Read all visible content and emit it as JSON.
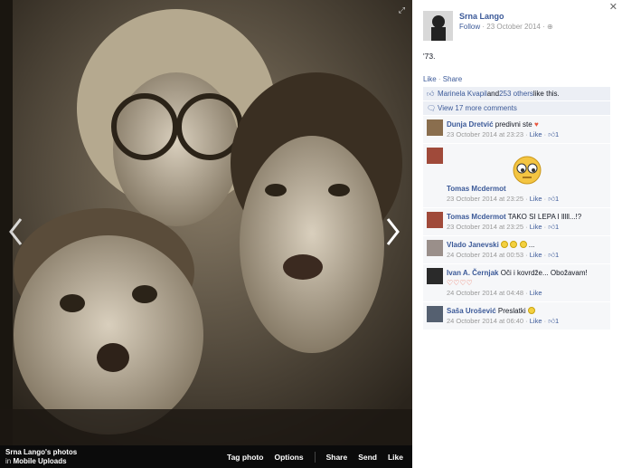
{
  "photo": {
    "album_owner": "Srna Lango's photos",
    "album_prefix": "in",
    "album_name": "Mobile Uploads",
    "actions": [
      "Tag photo",
      "Options",
      "Share",
      "Send",
      "Like"
    ]
  },
  "post": {
    "owner": "Srna Lango",
    "follow": "Follow",
    "date": "· 23 October 2014 ·",
    "caption": "'73.",
    "like_label": "Like",
    "share_label": "Share",
    "dot": " · "
  },
  "likes": {
    "name": "Marinela Kvapil",
    "middle": " and ",
    "others": "253 others",
    "suffix": " like this."
  },
  "more_comments": "View 17 more comments",
  "comments": [
    {
      "name": "Dunja Dretvić",
      "text": " predivni ste ",
      "time": "23 October 2014 at 23:23",
      "like": "Like",
      "count": "1"
    },
    {
      "name": "Tomas Mcdermot",
      "text": "",
      "time": "23 October 2014 at 23:25",
      "like": "Like",
      "count": "1"
    },
    {
      "name": "Tomas Mcdermot",
      "text": " TAKO SI LEPA I lllll...!?",
      "time": "23 October 2014 at 23:25",
      "like": "Like",
      "count": "1"
    },
    {
      "name": "Vlado Janevski",
      "text": " ...",
      "time": "24 October 2014 at 00:53",
      "like": "Like",
      "count": "1"
    },
    {
      "name": "Ivan A. Černjak",
      "text": " Oči i kovrdže... Obožavam! ",
      "time": "24 October 2014 at 04:48",
      "like": "Like",
      "count": ""
    },
    {
      "name": "Saša Urošević",
      "text": " Preslatki ",
      "time": "24 October 2014 at 06:40",
      "like": "Like",
      "count": "1"
    }
  ],
  "icons": {
    "close": "close-icon",
    "expand": "expand-icon",
    "prev": "chevron-left-icon",
    "next": "chevron-right-icon",
    "like_thumb": "thumbs-up-icon",
    "comment_bubble": "comment-icon",
    "globe": "globe-icon"
  },
  "colors": {
    "link": "#3b5998",
    "ufi_bg": "#eceff5",
    "heart": "#e9573f"
  }
}
